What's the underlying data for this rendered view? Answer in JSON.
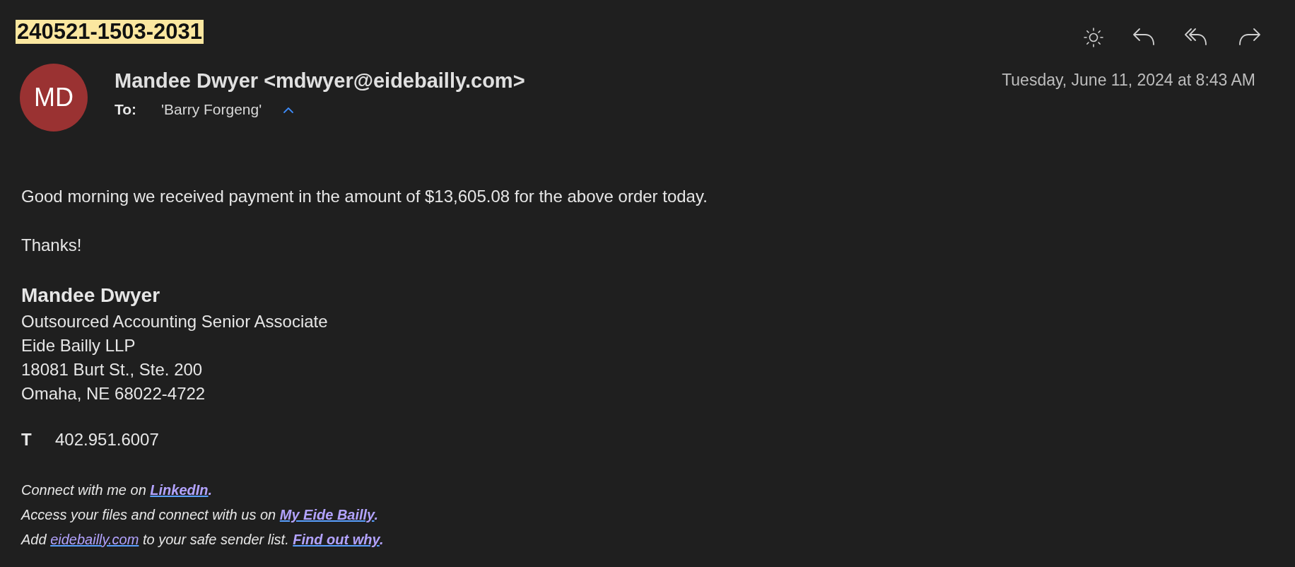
{
  "subject": "240521-1503-2031",
  "toolbar": [
    {
      "kind": "sun"
    },
    {
      "kind": "reply"
    },
    {
      "kind": "reply-all"
    },
    {
      "kind": "forward"
    }
  ],
  "sender": {
    "initials": "MD",
    "name": "Mandee Dwyer <mdwyer@eidebailly.com>",
    "to_label": "To:",
    "to": "'Barry Forgeng'",
    "expanded": true
  },
  "date": "Tuesday, June 11, 2024 at 8:43 AM",
  "body": [
    "Good morning we received payment in the amount of $13,605.08 for the above order today.",
    "Thanks!"
  ],
  "signature": {
    "name": "Mandee Dwyer",
    "lines": [
      "Outsourced Accounting Senior Associate",
      "Eide Bailly LLP",
      "18081 Burt St., Ste. 200",
      "Omaha, NE 68022-4722"
    ],
    "phone_label": "T",
    "phone": "402.951.6007"
  },
  "footer": [
    [
      {
        "kind": "text",
        "text": "Connect with me on "
      },
      {
        "kind": "link",
        "text": "LinkedIn",
        "bold": true
      },
      {
        "kind": "punct",
        "text": "."
      }
    ],
    [
      {
        "kind": "text",
        "text": "Access your files and connect with us on "
      },
      {
        "kind": "link",
        "text": "My Eide Bailly",
        "bold": true
      },
      {
        "kind": "punct",
        "text": "."
      }
    ],
    [
      {
        "kind": "text",
        "text": "Add "
      },
      {
        "kind": "link",
        "text": "eidebailly.com",
        "bold": false
      },
      {
        "kind": "text",
        "text": " to your safe sender list. "
      },
      {
        "kind": "link",
        "text": "Find out why",
        "bold": true
      },
      {
        "kind": "punct",
        "text": "."
      }
    ]
  ]
}
